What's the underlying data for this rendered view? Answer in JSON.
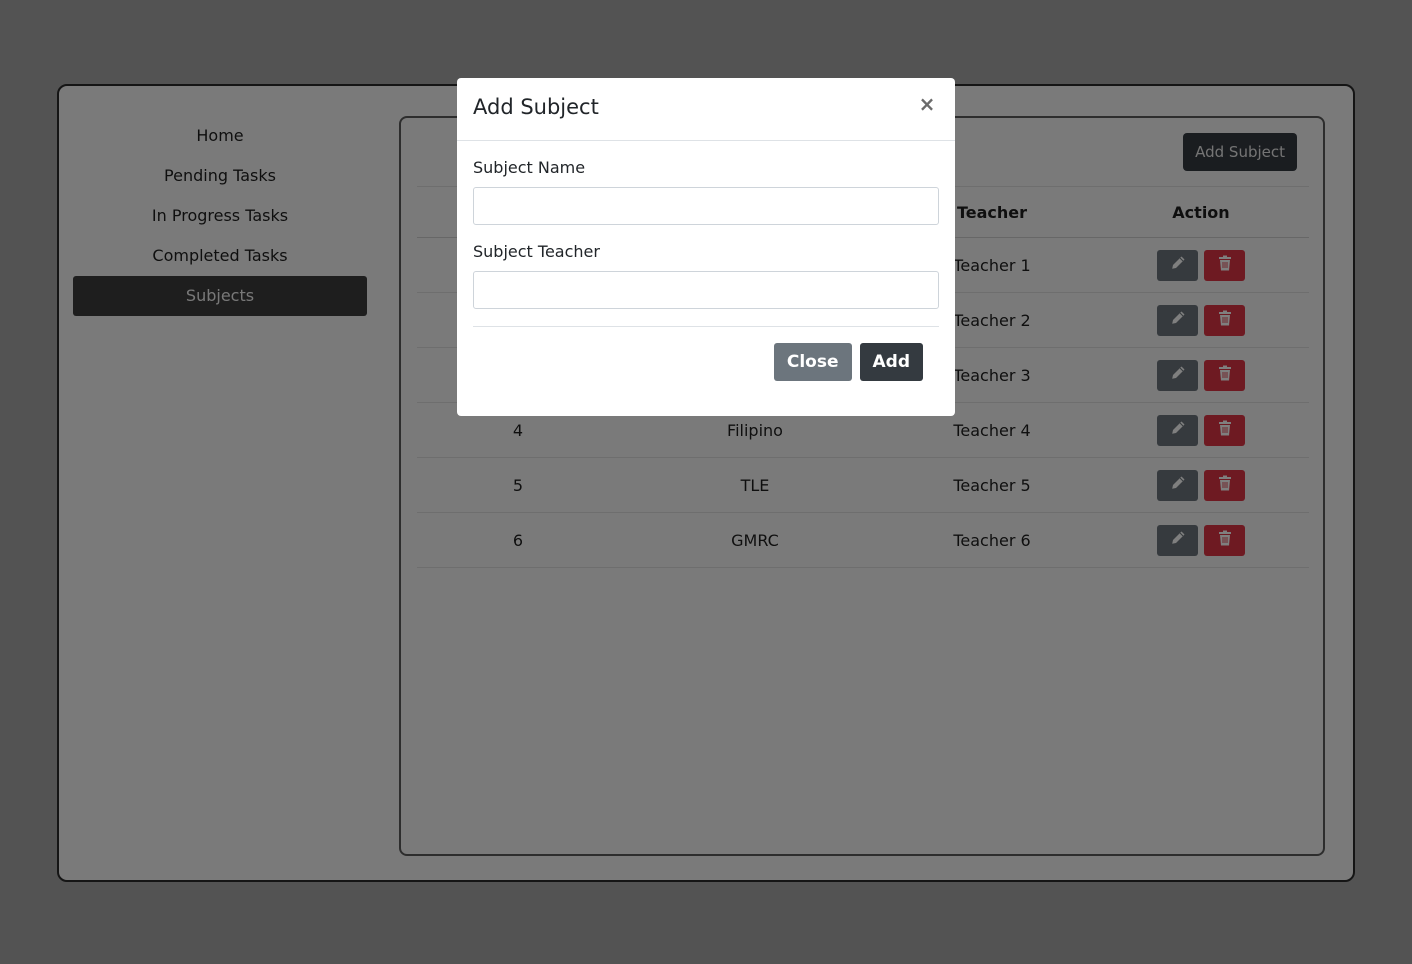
{
  "sidebar": {
    "items": [
      {
        "label": "Home"
      },
      {
        "label": "Pending Tasks"
      },
      {
        "label": "In Progress Tasks"
      },
      {
        "label": "Completed Tasks"
      },
      {
        "label": "Subjects",
        "active": true
      }
    ]
  },
  "content": {
    "add_subject_label": "Add Subject",
    "table": {
      "headers": [
        "",
        "",
        "Teacher",
        "Action"
      ],
      "rows": [
        {
          "id": "",
          "name": "",
          "teacher": "Teacher 1"
        },
        {
          "id": "",
          "name": "",
          "teacher": "Teacher 2"
        },
        {
          "id": "",
          "name": "",
          "teacher": "Teacher 3"
        },
        {
          "id": "4",
          "name": "Filipino",
          "teacher": "Teacher 4"
        },
        {
          "id": "5",
          "name": "TLE",
          "teacher": "Teacher 5"
        },
        {
          "id": "6",
          "name": "GMRC",
          "teacher": "Teacher 6"
        }
      ]
    }
  },
  "modal": {
    "title": "Add Subject",
    "close_glyph": "×",
    "fields": {
      "subject_name": {
        "label": "Subject Name",
        "value": "",
        "placeholder": ""
      },
      "subject_teacher": {
        "label": "Subject Teacher",
        "value": "",
        "placeholder": ""
      }
    },
    "close_label": "Close",
    "add_label": "Add"
  },
  "icons": {
    "edit": "pencil-icon",
    "delete": "trash-icon"
  },
  "colors": {
    "edit": "#6c757d",
    "delete": "#dc3545",
    "dark": "#343a40",
    "backdrop": "rgba(0,0,0,0.5)"
  }
}
